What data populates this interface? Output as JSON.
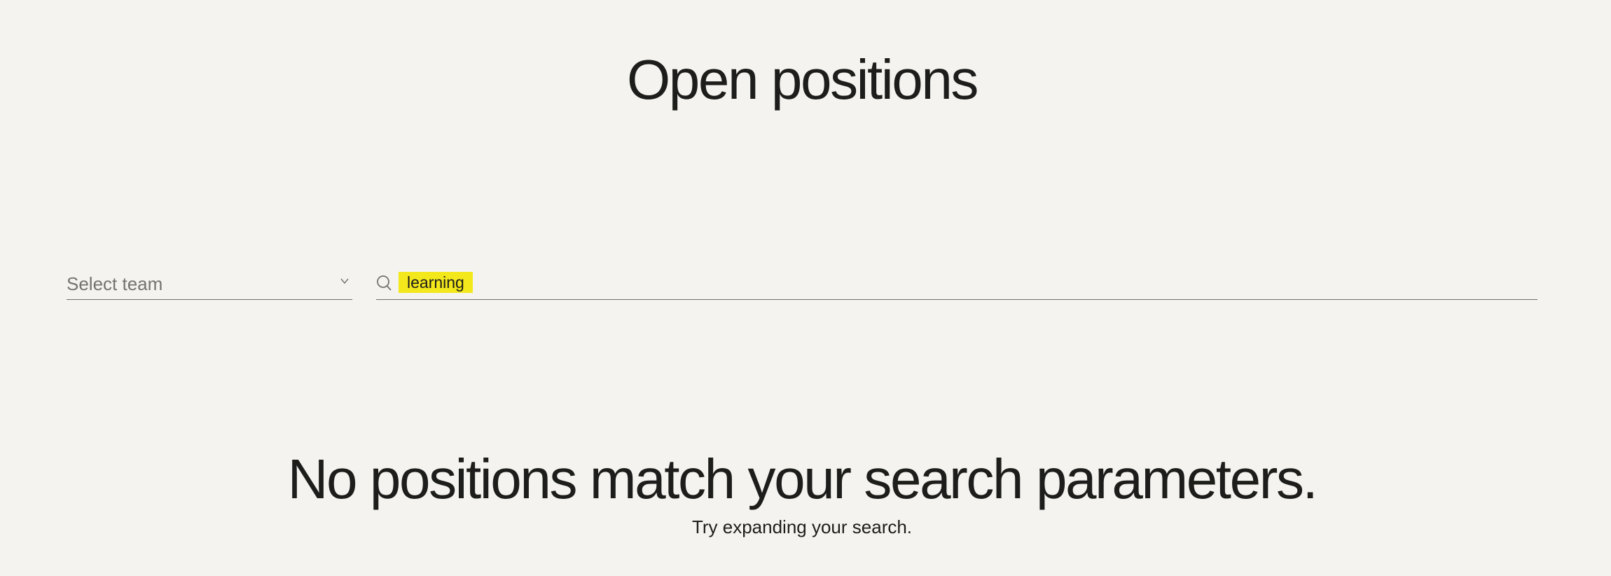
{
  "header": {
    "title": "Open positions"
  },
  "filters": {
    "team_select": {
      "placeholder": "Select team",
      "icon": "chevron-down-icon"
    },
    "search": {
      "value": "learning",
      "icon": "search-icon",
      "highlight_color": "#f3e81b"
    }
  },
  "results": {
    "empty_heading": "No positions match your search parameters.",
    "empty_hint": "Try expanding your search."
  },
  "colors": {
    "background": "#f4f3ef",
    "text": "#1d1d1b",
    "muted": "#74746f"
  }
}
